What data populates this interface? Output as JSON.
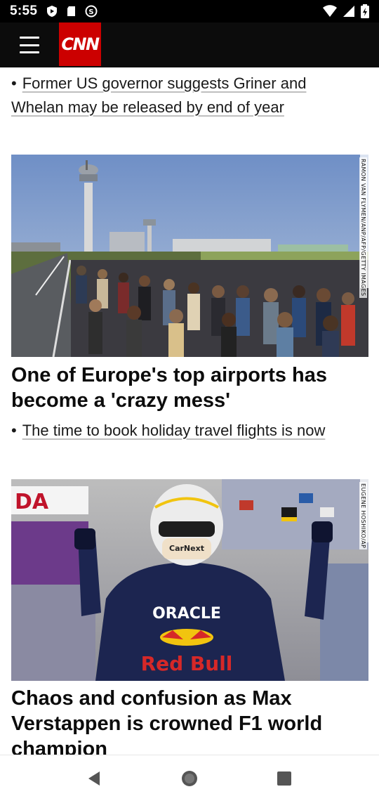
{
  "status_bar": {
    "time": "5:55",
    "left_icons": [
      "play-protect-icon",
      "sd-card-icon",
      "stop-icon"
    ],
    "right_icons": [
      "wifi-icon",
      "signal-icon",
      "battery-icon"
    ]
  },
  "header": {
    "logo_text": "CNN",
    "menu_icon": "hamburger-menu-icon",
    "brand_color": "#cc0000"
  },
  "stories": [
    {
      "related": [
        {
          "bullet": "•",
          "text": "Former US governor suggests Griner and"
        },
        {
          "bullet": "",
          "text": "Whelan may be released by end of year"
        }
      ]
    },
    {
      "image_alt": "Crowds of travelers queue outside at an airport with control tower",
      "image_credit": "RAMON VAN FLYMEN/ANP/AFP/GETTY IMAGES",
      "headline_line1": "One of Europe's top airports has",
      "headline_line2": "become a 'crazy mess'",
      "related": [
        {
          "bullet": "•",
          "text": "The time to book holiday travel flights is now"
        }
      ]
    },
    {
      "image_alt": "F1 driver in helmet celebrating with raised fists",
      "image_credit": "EUGENE HOSHIKO/AP",
      "image_sign": "DA",
      "helmet_text": "CarNext",
      "suit_text1": "ORACLE",
      "suit_text2": "Red Bull",
      "headline_line1": "Chaos and confusion as Max",
      "headline_line2": "Verstappen is crowned F1 world",
      "headline_line3": "champion"
    }
  ],
  "nav_bar": {
    "buttons": [
      "back-icon",
      "home-icon",
      "recents-icon"
    ]
  }
}
